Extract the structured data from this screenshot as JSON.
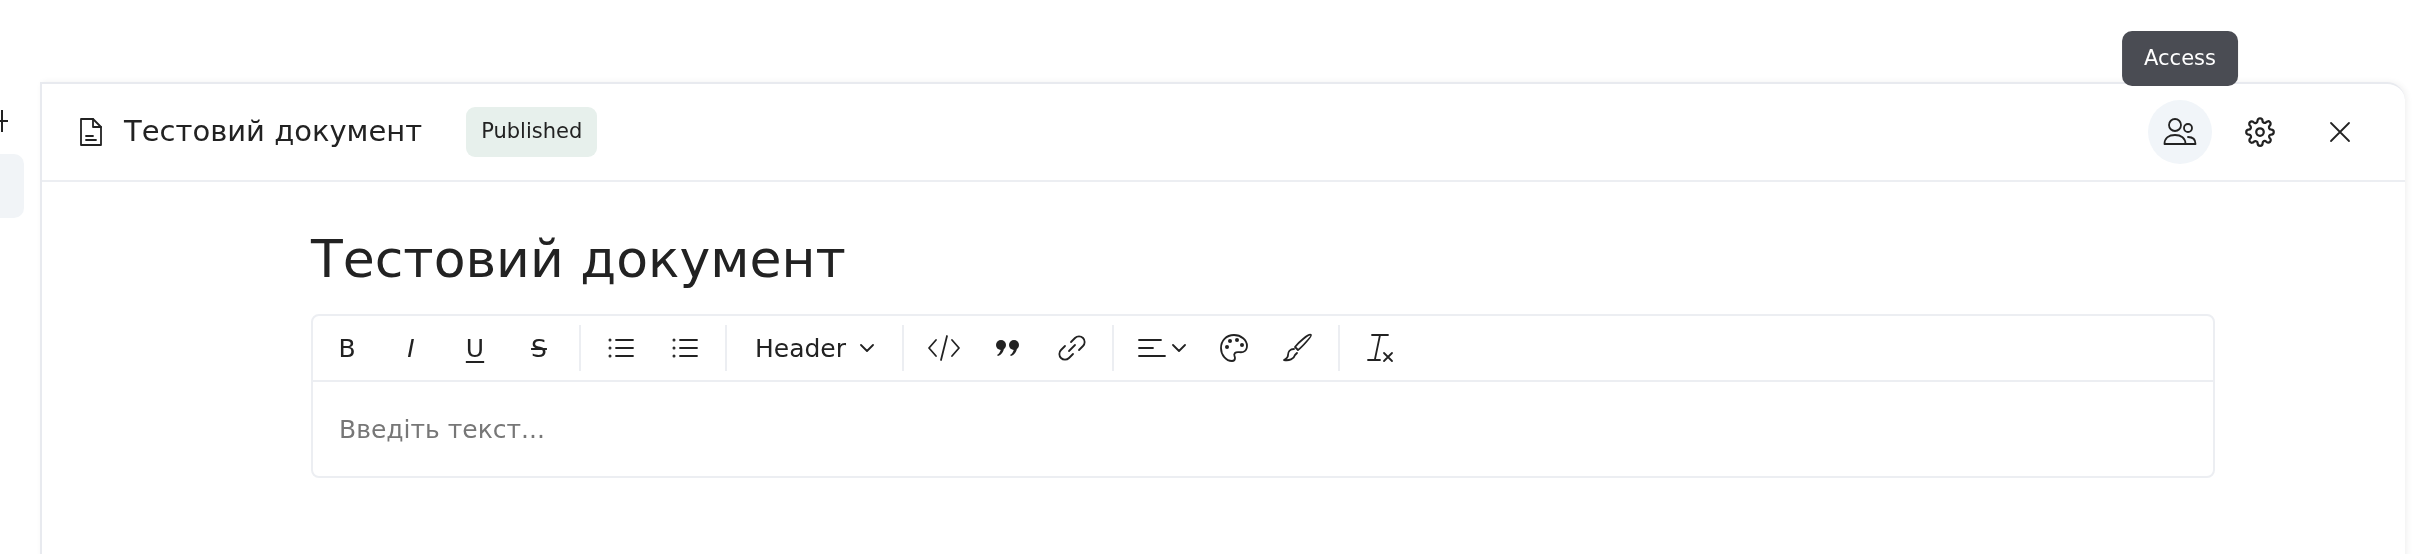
{
  "sidebar": {
    "items": [
      {
        "selected": true
      }
    ]
  },
  "document": {
    "title": "Тестовий документ",
    "status": "Published",
    "actions": [
      {
        "active": true,
        "tooltip": "Access"
      },
      {
        "active": false
      },
      {
        "active": false
      }
    ]
  },
  "editor": {
    "heading": "Тестовий документ",
    "toolbar": [
      [
        {
          "kind": "text",
          "label": "B"
        },
        {
          "kind": "text",
          "label": "I"
        },
        {
          "kind": "text",
          "label": "U"
        },
        {
          "kind": "text",
          "label": "S"
        }
      ],
      [
        {
          "kind": "icon"
        },
        {
          "kind": "icon"
        }
      ],
      [
        {
          "kind": "dropdown",
          "label": "Header"
        }
      ],
      [
        {
          "kind": "icon"
        },
        {
          "kind": "icon"
        },
        {
          "kind": "icon"
        }
      ],
      [
        {
          "kind": "icon_dropdown"
        },
        {
          "kind": "icon"
        },
        {
          "kind": "icon"
        }
      ],
      [
        {
          "kind": "icon"
        }
      ]
    ],
    "placeholder": "Введіть текст..."
  }
}
